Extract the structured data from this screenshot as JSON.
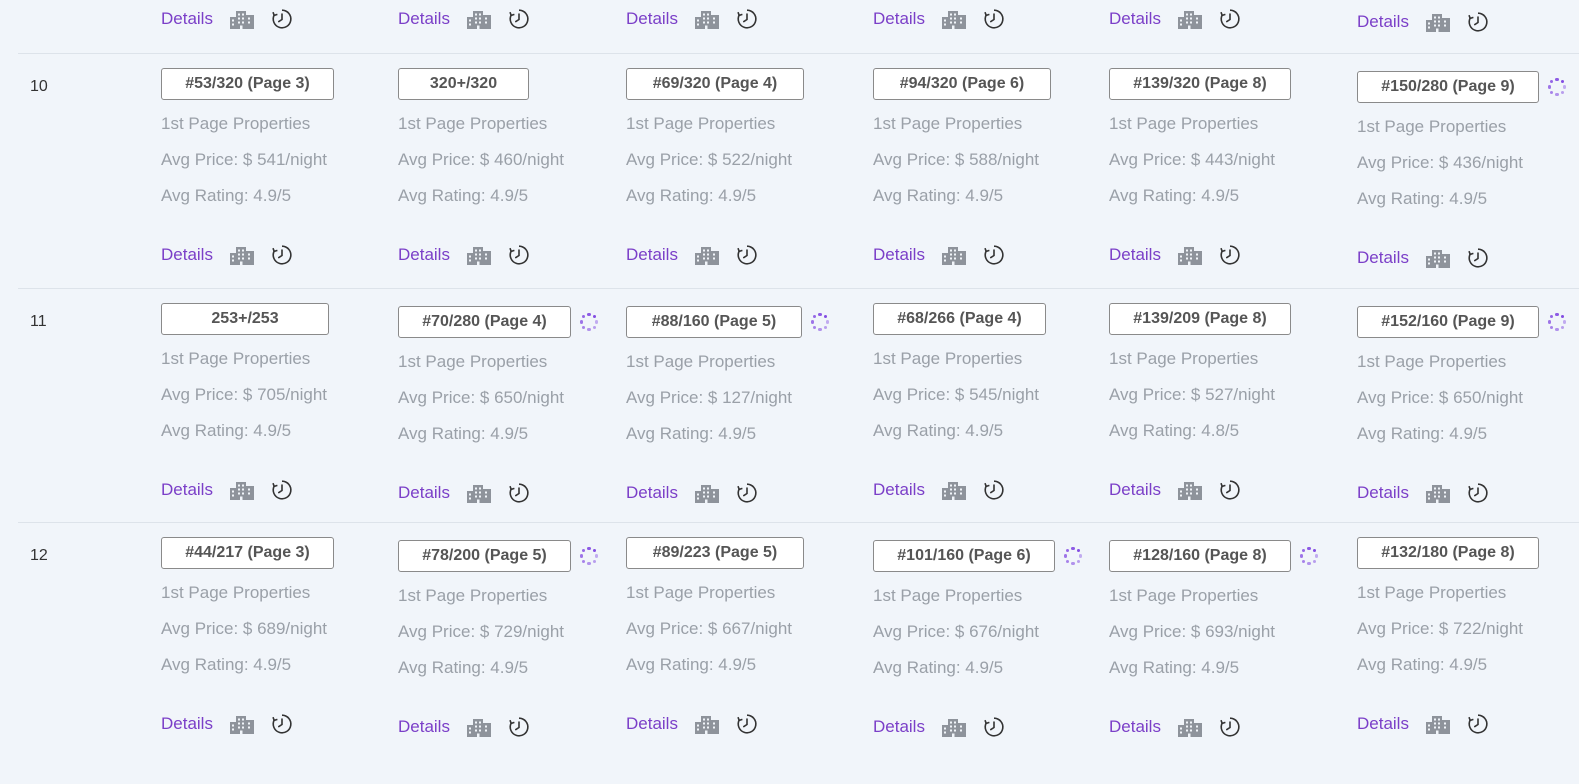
{
  "labels": {
    "details": "Details",
    "first_page": "1st Page Properties"
  },
  "icons": {
    "building": "building-icon",
    "history": "history-clock-icon",
    "loading": "loading-spinner-icon"
  },
  "colors": {
    "accent": "#7b3fc8",
    "muted_text": "#9aa0a8",
    "background": "#f1f5fa"
  },
  "rows": [
    {
      "num": "10",
      "cells": [
        {
          "rank": "#53/320 (Page 3)",
          "loading": false,
          "price": "Avg Price: $ 541/night",
          "rating": "Avg Rating: 4.9/5"
        },
        {
          "rank": "320+/320",
          "loading": false,
          "price": "Avg Price: $ 460/night",
          "rating": "Avg Rating: 4.9/5"
        },
        {
          "rank": "#69/320 (Page 4)",
          "loading": false,
          "price": "Avg Price: $ 522/night",
          "rating": "Avg Rating: 4.9/5"
        },
        {
          "rank": "#94/320 (Page 6)",
          "loading": false,
          "price": "Avg Price: $ 588/night",
          "rating": "Avg Rating: 4.9/5"
        },
        {
          "rank": "#139/320 (Page 8)",
          "loading": false,
          "price": "Avg Price: $ 443/night",
          "rating": "Avg Rating: 4.9/5"
        },
        {
          "rank": "#150/280 (Page 9)",
          "loading": true,
          "price": "Avg Price: $ 436/night",
          "rating": "Avg Rating: 4.9/5"
        }
      ]
    },
    {
      "num": "11",
      "cells": [
        {
          "rank": "253+/253",
          "loading": false,
          "price": "Avg Price: $ 705/night",
          "rating": "Avg Rating: 4.9/5"
        },
        {
          "rank": "#70/280 (Page 4)",
          "loading": true,
          "price": "Avg Price: $ 650/night",
          "rating": "Avg Rating: 4.9/5"
        },
        {
          "rank": "#88/160 (Page 5)",
          "loading": true,
          "price": "Avg Price: $ 127/night",
          "rating": "Avg Rating: 4.9/5"
        },
        {
          "rank": "#68/266 (Page 4)",
          "loading": false,
          "price": "Avg Price: $ 545/night",
          "rating": "Avg Rating: 4.9/5"
        },
        {
          "rank": "#139/209 (Page 8)",
          "loading": false,
          "price": "Avg Price: $ 527/night",
          "rating": "Avg Rating: 4.8/5"
        },
        {
          "rank": "#152/160 (Page 9)",
          "loading": true,
          "price": "Avg Price: $ 650/night",
          "rating": "Avg Rating: 4.9/5"
        }
      ]
    },
    {
      "num": "12",
      "cells": [
        {
          "rank": "#44/217 (Page 3)",
          "loading": false,
          "price": "Avg Price: $ 689/night",
          "rating": "Avg Rating: 4.9/5"
        },
        {
          "rank": "#78/200 (Page 5)",
          "loading": true,
          "price": "Avg Price: $ 729/night",
          "rating": "Avg Rating: 4.9/5"
        },
        {
          "rank": "#89/223 (Page 5)",
          "loading": false,
          "price": "Avg Price: $ 667/night",
          "rating": "Avg Rating: 4.9/5"
        },
        {
          "rank": "#101/160 (Page 6)",
          "loading": true,
          "price": "Avg Price: $ 676/night",
          "rating": "Avg Rating: 4.9/5"
        },
        {
          "rank": "#128/160 (Page 8)",
          "loading": true,
          "price": "Avg Price: $ 693/night",
          "rating": "Avg Rating: 4.9/5"
        },
        {
          "rank": "#132/180 (Page 8)",
          "loading": false,
          "price": "Avg Price: $ 722/night",
          "rating": "Avg Rating: 4.9/5"
        }
      ]
    }
  ]
}
